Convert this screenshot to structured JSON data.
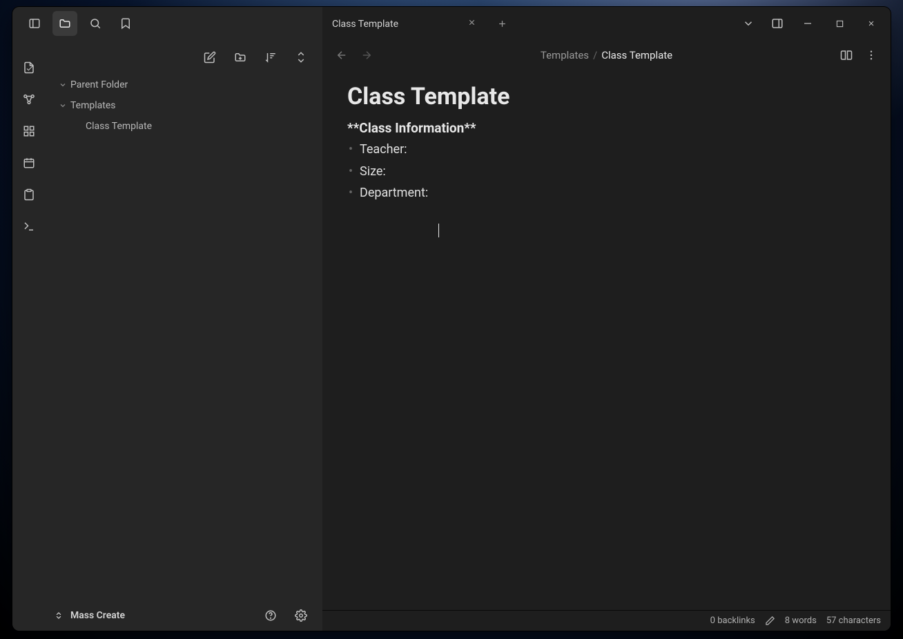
{
  "tabs": [
    {
      "title": "Class Template"
    }
  ],
  "sidebar": {
    "tree": [
      {
        "label": "Parent Folder",
        "indent": 1,
        "is_folder": true
      },
      {
        "label": "Templates",
        "indent": 2,
        "is_folder": true
      },
      {
        "label": "Class Template",
        "indent": 3,
        "is_folder": false,
        "active": true
      }
    ],
    "footer_label": "Mass Create"
  },
  "breadcrumb": {
    "parent": "Templates",
    "current": "Class Template"
  },
  "note": {
    "title": "Class Template",
    "info_header": "**Class Information**",
    "bullets": [
      "Teacher:",
      "Size:",
      "Department:"
    ]
  },
  "status": {
    "backlinks": "0 backlinks",
    "words": "8 words",
    "chars": "57 characters"
  }
}
